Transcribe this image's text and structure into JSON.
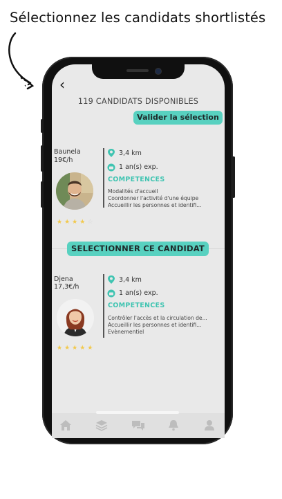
{
  "caption": "Sélectionnez les candidats shortlistés",
  "header": {
    "back_label": "‹",
    "count_label": "119 CANDIDATS DISPONIBLES"
  },
  "actions": {
    "validate_label": "Valider la sélection",
    "select_label": "SELECTIONNER CE CANDIDAT"
  },
  "candidates": [
    {
      "name": "Baunela",
      "rate": "19€/h",
      "distance": "3,4 km",
      "experience": "1 an(s) exp.",
      "competences_label": "COMPETENCES",
      "skills": [
        "Modalités d'accueil",
        "Coordonner l'activité d'une équipe",
        "Accueillir les personnes et identifi..."
      ],
      "rating": 4,
      "rating_max": 5
    },
    {
      "name": "Djena",
      "rate": "17,3€/h",
      "distance": "3,4 km",
      "experience": "1 an(s) exp.",
      "competences_label": "COMPETENCES",
      "skills": [
        "Contrôler l'accès et la circulation de...",
        "Accueillir les personnes et identifi...",
        "Evènementiel"
      ],
      "rating": 5,
      "rating_max": 5
    }
  ],
  "nav": {
    "items": [
      "home-icon",
      "layers-icon",
      "chat-icon",
      "bell-icon",
      "user-icon"
    ]
  },
  "colors": {
    "accent": "#58d1c0",
    "star": "#f2c94c",
    "phone": "#101010",
    "screen": "#e9e9e9"
  }
}
